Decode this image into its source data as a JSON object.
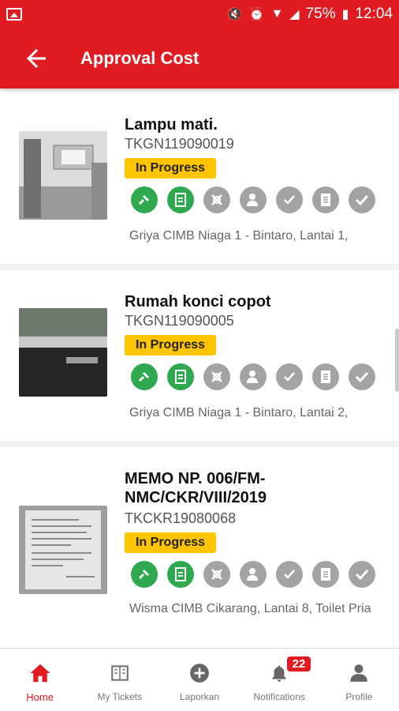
{
  "status_bar": {
    "battery": "75%",
    "time": "12:04"
  },
  "app_bar": {
    "title": "Approval Cost"
  },
  "tickets": [
    {
      "title": "Lampu mati.",
      "code": "TKGN119090019",
      "status": "In Progress",
      "location": "Griya CIMB Niaga 1 - Bintaro, Lantai 1,",
      "steps_done": 2
    },
    {
      "title": "Rumah konci copot",
      "code": "TKGN119090005",
      "status": "In Progress",
      "location": "Griya CIMB Niaga 1 - Bintaro, Lantai 2,",
      "steps_done": 2
    },
    {
      "title": "MEMO NP. 006/FM-NMC/CKR/VIII/2019",
      "code": "TKCKR19080068",
      "status": "In Progress",
      "location": "Wisma CIMB Cikarang, Lantai 8, Toilet Pria",
      "steps_done": 2
    }
  ],
  "step_icons": [
    "tools-check-icon",
    "document-check-icon",
    "wrench-cross-icon",
    "user-approval-icon",
    "hand-check-icon",
    "report-icon",
    "check-icon"
  ],
  "bottom_nav": {
    "home": "Home",
    "my_tickets": "My Tickets",
    "laporkan": "Laporkan",
    "notifications": "Notifications",
    "notifications_count": "22",
    "profile": "Profile"
  },
  "colors": {
    "primary": "#e01b22",
    "success": "#2fa84f",
    "pending": "#a3a3a3",
    "badge": "#ffc400"
  }
}
